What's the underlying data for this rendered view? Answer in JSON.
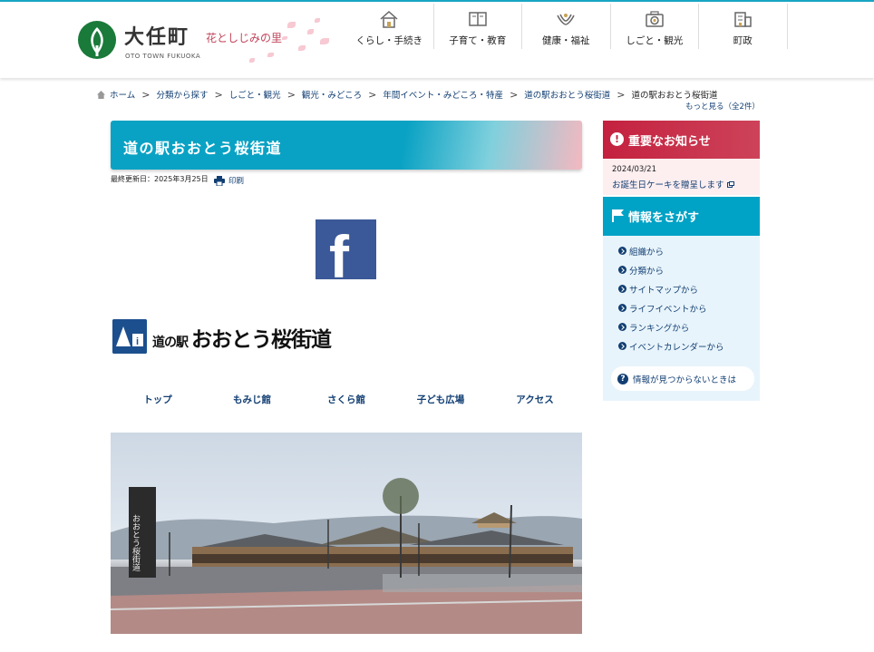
{
  "header": {
    "logo_title": "大任町",
    "logo_sub": "OTO TOWN FUKUOKA",
    "logo_tagline": "花としじみの里",
    "nav": [
      {
        "label": "くらし・手続き",
        "icon": "house-icon"
      },
      {
        "label": "子育て・教育",
        "icon": "book-icon"
      },
      {
        "label": "健康・福祉",
        "icon": "hands-icon"
      },
      {
        "label": "しごと・観光",
        "icon": "camera-icon"
      },
      {
        "label": "町政",
        "icon": "building-icon"
      }
    ]
  },
  "breadcrumb": {
    "items": [
      "ホーム",
      "分類から探す",
      "しごと・観光",
      "観光・みどころ",
      "年間イベント・みどころ・特産",
      "道の駅おおとう桜街道"
    ],
    "current": "道の駅おおとう桜街道",
    "more": "もっと見る（全2件）"
  },
  "main": {
    "title": "道の駅おおとう桜街道",
    "updated": "最終更新日：2025年3月25日",
    "print": "印刷",
    "facebook_letter": "f",
    "station_prefix": "道の駅",
    "station_name": "おおとう桜街道",
    "sub_nav": [
      "トップ",
      "もみじ館",
      "さくら館",
      "子ども広場",
      "アクセス"
    ],
    "photo_sign": "おおとう桜街道"
  },
  "sidebar": {
    "notice_title": "重要なお知らせ",
    "notice_icon": "!",
    "notice_date": "2024/03/21",
    "notice_link": "お誕生日ケーキを贈呈します",
    "search_title": "情報をさがす",
    "search_items": [
      "組織から",
      "分類から",
      "サイトマップから",
      "ライフイベントから",
      "ランキングから",
      "イベントカレンダーから"
    ],
    "not_found": "情報が見つからないときは",
    "not_found_icon": "?"
  },
  "colors": {
    "accent_cyan": "#00a2c6",
    "notice_red": "#c4213f",
    "link_navy": "#123f73",
    "facebook_blue": "#3b5998"
  }
}
